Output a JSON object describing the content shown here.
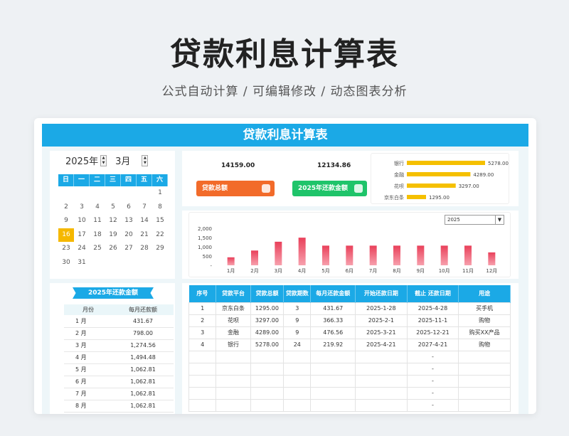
{
  "page": {
    "title": "贷款利息计算表",
    "subtitle": "公式自动计算 / 可编辑修改 / 动态图表分析"
  },
  "sheet": {
    "banner": "贷款利息计算表"
  },
  "calendar": {
    "year": "2025年",
    "month": "3月",
    "weekdays": [
      "日",
      "一",
      "二",
      "三",
      "四",
      "五",
      "六"
    ],
    "weeks": [
      [
        "",
        "",
        "",
        "",
        "",
        "",
        "1"
      ],
      [
        "2",
        "3",
        "4",
        "5",
        "6",
        "7",
        "8"
      ],
      [
        "9",
        "10",
        "11",
        "12",
        "13",
        "14",
        "15"
      ],
      [
        "16",
        "17",
        "18",
        "19",
        "20",
        "21",
        "22"
      ],
      [
        "23",
        "24",
        "25",
        "26",
        "27",
        "28",
        "29"
      ],
      [
        "30",
        "31",
        "",
        "",
        "",
        "",
        ""
      ]
    ],
    "today": "16",
    "today_color": "#f5b800"
  },
  "monthly": {
    "ribbon": "2025年还款金额",
    "headers": [
      "月份",
      "每月还款额"
    ],
    "rows": [
      [
        "1 月",
        "431.67"
      ],
      [
        "2 月",
        "798.00"
      ],
      [
        "3 月",
        "1,274.56"
      ],
      [
        "4 月",
        "1,494.48"
      ],
      [
        "5 月",
        "1,062.81"
      ],
      [
        "6 月",
        "1,062.81"
      ],
      [
        "7 月",
        "1,062.81"
      ],
      [
        "8 月",
        "1,062.81"
      ]
    ]
  },
  "kpi": {
    "total_value": "14159.00",
    "total_label": "贷款总额",
    "total_color": "#f26b2a",
    "year_value": "12134.86",
    "year_label": "2025年还款金额",
    "year_color": "#1fc46a"
  },
  "chart_data": [
    {
      "type": "bar",
      "orientation": "horizontal",
      "categories": [
        "银行",
        "金融",
        "花呗",
        "京东白条"
      ],
      "values": [
        5278.0,
        4289.0,
        3297.0,
        1295.0
      ],
      "value_labels": [
        "5278.00",
        "4289.00",
        "3297.00",
        "1295.00"
      ],
      "color": "#f5c000",
      "xlim": [
        0,
        6000
      ]
    },
    {
      "type": "bar",
      "categories": [
        "1月",
        "2月",
        "3月",
        "4月",
        "5月",
        "6月",
        "7月",
        "8月",
        "9月",
        "10月",
        "11月",
        "12月"
      ],
      "values": [
        431.67,
        798.0,
        1274.56,
        1494.48,
        1062.81,
        1062.81,
        1062.81,
        1062.81,
        1062.81,
        1062.81,
        1062.81,
        698.0
      ],
      "y_ticks": [
        "2,000",
        "1,500",
        "1,000",
        "500",
        "-"
      ],
      "ylim": [
        0,
        2000
      ],
      "color": "#e9405a"
    }
  ],
  "year_select": {
    "value": "2025"
  },
  "loans": {
    "headers": [
      "序号",
      "贷款平台",
      "贷款总额",
      "贷款期数",
      "每月还款金额",
      "开始还款日期",
      "截止 还款日期",
      "用途"
    ],
    "rows": [
      [
        "1",
        "京东白条",
        "1295.00",
        "3",
        "431.67",
        "2025-1-28",
        "2025-4-28",
        "买手机"
      ],
      [
        "2",
        "花呗",
        "3297.00",
        "9",
        "366.33",
        "2025-2-1",
        "2025-11-1",
        "购物"
      ],
      [
        "3",
        "金融",
        "4289.00",
        "9",
        "476.56",
        "2025-3-21",
        "2025-12-21",
        "购买XX产品"
      ],
      [
        "4",
        "银行",
        "5278.00",
        "24",
        "219.92",
        "2025-4-21",
        "2027-4-21",
        "购物"
      ],
      [
        "",
        "",
        "",
        "",
        "",
        "",
        "-",
        ""
      ],
      [
        "",
        "",
        "",
        "",
        "",
        "",
        "-",
        ""
      ],
      [
        "",
        "",
        "",
        "",
        "",
        "",
        "-",
        ""
      ],
      [
        "",
        "",
        "",
        "",
        "",
        "",
        "-",
        ""
      ],
      [
        "",
        "",
        "",
        "",
        "",
        "",
        "-",
        ""
      ]
    ]
  }
}
